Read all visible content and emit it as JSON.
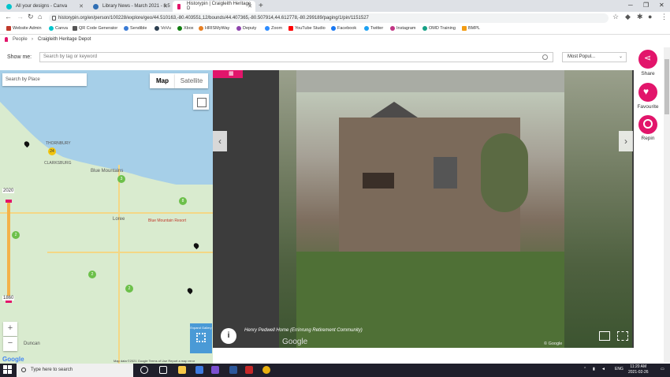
{
  "browser": {
    "tabs": [
      {
        "label": "All your designs - Canva",
        "active": false
      },
      {
        "label": "Library News - March 2021 - 8.5",
        "active": false
      },
      {
        "label": "Historypin | Craigleith Heritage D",
        "active": true
      }
    ],
    "url": "historypin.org/en/person/100228/explore/geo/44.510163,-80.403551,12/bounds/44.407365,-80.507914,44.612778,-80.299189/paging/1/pin/1151527",
    "bookmarks": [
      "Website Admin",
      "Canva",
      "QR Code Generator",
      "Sendible",
      "VoVu",
      "Xbox",
      "HRISMyWay",
      "Deputy",
      "Zoom",
      "YouTube Studio",
      "Facebook",
      "Twitter",
      "Instagram",
      "OMD Training",
      "BMPL"
    ]
  },
  "breadcrumb": {
    "root": "People",
    "current": "Craigleith Heritage Depot"
  },
  "toolbar": {
    "show_me_label": "Show me:",
    "search_placeholder": "Search by tag or keyword",
    "sort_value": "Most Popul..."
  },
  "map": {
    "place_search_placeholder": "Search by Place",
    "map_tab": "Map",
    "satellite_tab": "Satellite",
    "year_top": "2020",
    "year_bottom": "1860",
    "expand_label": "Expand Gallery",
    "labels": [
      "THORNBURY",
      "CLARKSBURG",
      "Blue Mountains",
      "Loree",
      "Blue Mountain Resort",
      "Duncan"
    ],
    "clusters": [
      "24",
      "3",
      "8",
      "2",
      "2",
      "2"
    ],
    "google": "Google",
    "footer": "Map data ©2021 Google   Terms of Use   Report a map error",
    "zoom_in": "+",
    "zoom_out": "−"
  },
  "viewer": {
    "caption": "Henry Pedwell Home (Errinrung Retirement Community)",
    "google": "Google",
    "copyright": "© Google",
    "prev": "‹",
    "next": "›",
    "info": "i"
  },
  "actions": [
    {
      "label": "Share"
    },
    {
      "label": "Favourite"
    },
    {
      "label": "Repin"
    }
  ],
  "taskbar": {
    "search_placeholder": "Type here to search",
    "time": "11:20 AM",
    "date": "2021-02-26",
    "lang": "ENG"
  }
}
